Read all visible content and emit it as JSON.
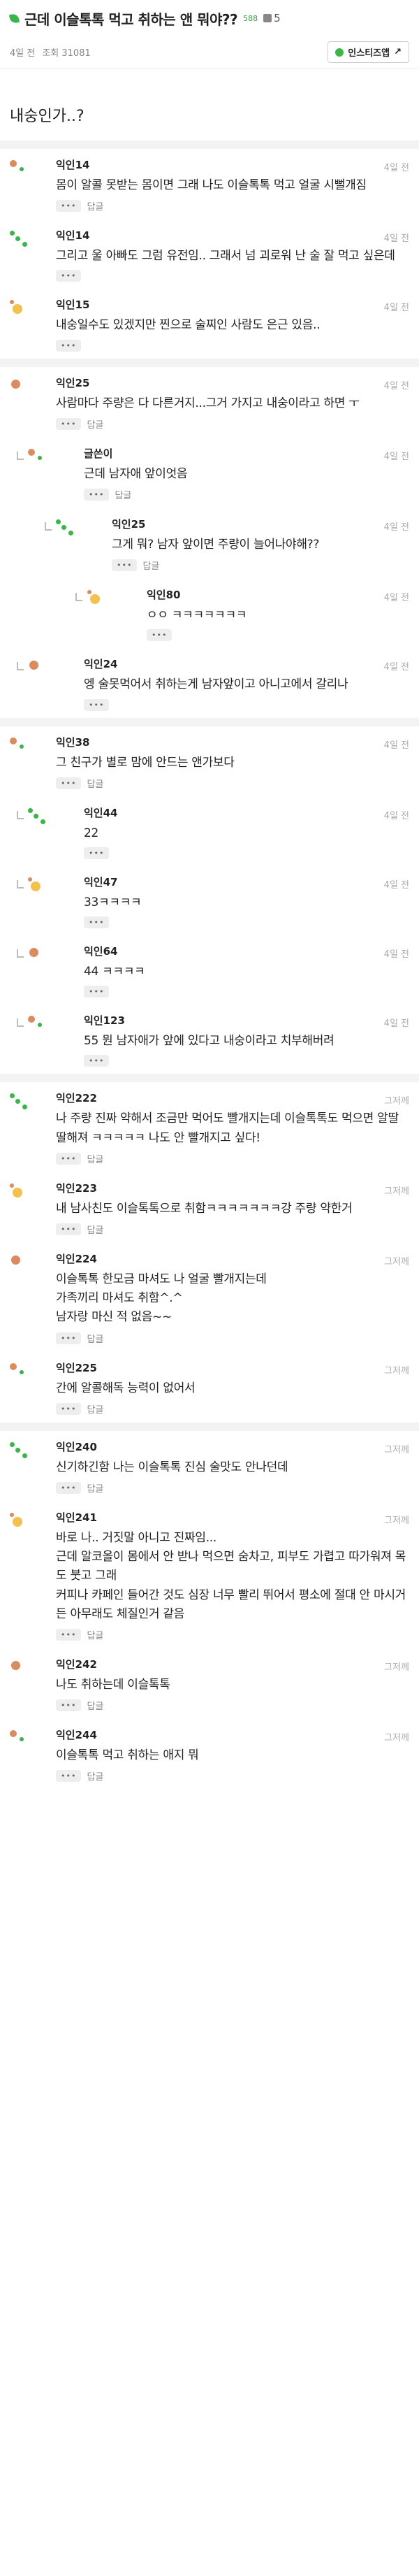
{
  "header": {
    "title": "근데 이슬톡톡 먹고 취하는 앤 뭐야??",
    "comment_count": "588",
    "likes": "5"
  },
  "meta": {
    "time": "4일 전",
    "views": "조회 31081",
    "instiz_button": "인스티즈앱"
  },
  "post": {
    "body": "내숭인가..?"
  },
  "labels": {
    "reply": "답글",
    "more": "•••"
  },
  "comments": [
    {
      "name": "익인14",
      "date": "4일 전",
      "text": "몸이 알콜 못받는 몸이면 그래 나도 이슬톡톡 먹고 얼굴 시뻘개짐",
      "level": 0,
      "reply": true
    },
    {
      "name": "익인14",
      "date": "4일 전",
      "text": "그리고 울 아빠도 그럼 유전임.. 그래서 넘 괴로워 난 술 잘 먹고 싶은데",
      "level": 0,
      "reply": false
    },
    {
      "name": "익인15",
      "date": "4일 전",
      "text": "내숭일수도 있겠지만 찐으로 술찌인 사람도 은근 있음..",
      "level": 0,
      "reply": false,
      "sep_after": true
    },
    {
      "name": "익인25",
      "date": "4일 전",
      "text": "사람마다 주량은 다 다른거지...그거 가지고 내숭이라고 하면 ㅜ",
      "level": 0,
      "reply": true
    },
    {
      "name": "글쓴이",
      "date": "4일 전",
      "text": "근데 남자애 앞이엇음",
      "level": 1,
      "reply": true
    },
    {
      "name": "익인25",
      "date": "4일 전",
      "text": "그게 뭐? 남자 앞이면 주량이 늘어나야해??",
      "level": 2,
      "reply": true
    },
    {
      "name": "익인80",
      "date": "4일 전",
      "text": "ㅇㅇ ㅋㅋㅋㅋㅋㅋㅋ",
      "level": 3,
      "reply": false
    },
    {
      "name": "익인24",
      "date": "4일 전",
      "text": "엥 술못먹어서 취하는게 남자앞이고 아니고에서 갈리나",
      "level": 1,
      "reply": false,
      "sep_after": true
    },
    {
      "name": "익인38",
      "date": "4일 전",
      "text": "그 친구가 별로 맘에 안드는 앤가보다",
      "level": 0,
      "reply": true
    },
    {
      "name": "익인44",
      "date": "4일 전",
      "text": "22",
      "level": 1,
      "reply": false
    },
    {
      "name": "익인47",
      "date": "4일 전",
      "text": "33ㅋㅋㅋㅋ",
      "level": 1,
      "reply": false
    },
    {
      "name": "익인64",
      "date": "4일 전",
      "text": "44 ㅋㅋㅋㅋ",
      "level": 1,
      "reply": false
    },
    {
      "name": "익인123",
      "date": "4일 전",
      "text": "55 뭔 남자애가 앞에 있다고 내숭이라고 치부해버려",
      "level": 1,
      "reply": false,
      "sep_after": true
    },
    {
      "name": "익인222",
      "date": "그저께",
      "text": "나 주량 진짜 약해서 조금만 먹어도 빨개지는데 이슬톡톡도 먹으면 알딸딸해져 ㅋㅋㅋㅋㅋ 나도 안 빨개지고 싶다!",
      "level": 0,
      "reply": true
    },
    {
      "name": "익인223",
      "date": "그저께",
      "text": "내 남사친도 이슬톡톡으로 취함ㅋㅋㅋㅋㅋㅋㅋ강 주량 약한거",
      "level": 0,
      "reply": true
    },
    {
      "name": "익인224",
      "date": "그저께",
      "text": "이슬톡톡 한모금 마셔도 나 얼굴 빨개지는데\n가족끼리 마셔도 취함^.^\n남자랑 마신 적 없음~~",
      "level": 0,
      "reply": true
    },
    {
      "name": "익인225",
      "date": "그저께",
      "text": "간에 알콜해독 능력이 없어서",
      "level": 0,
      "reply": true,
      "sep_after": true
    },
    {
      "name": "익인240",
      "date": "그저께",
      "text": "신기하긴함 나는 이슬톡톡 진심 술맛도 안나던데",
      "level": 0,
      "reply": true
    },
    {
      "name": "익인241",
      "date": "그저께",
      "text": "바로 나.. 거짓말 아니고 진짜임...\n근데 알코올이 몸에서 안 받나 먹으면 숨차고, 피부도 가렵고 따가워져 목도 붓고 그래\n커피나 카페인 들어간 것도 심장 너무 빨리 뛰어서 평소에 절대 안 마시거든 아무래도 체질인거 같음",
      "level": 0,
      "reply": true
    },
    {
      "name": "익인242",
      "date": "그저께",
      "text": "나도 취하는데 이슬톡톡",
      "level": 0,
      "reply": true
    },
    {
      "name": "익인244",
      "date": "그저께",
      "text": "이슬톡톡 먹고 취하는 애지 뭐",
      "level": 0,
      "reply": true
    }
  ],
  "colors": {
    "brand": "#3bb54a",
    "avatar1": "#d98c5f",
    "avatar2": "#3bb54a",
    "avatar3": "#f2c14e"
  }
}
